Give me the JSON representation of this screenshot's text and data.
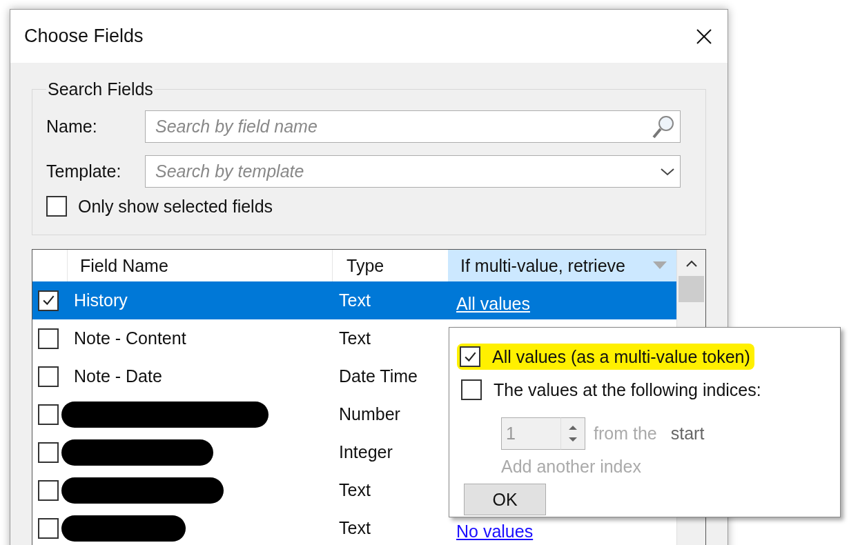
{
  "window": {
    "title": "Choose Fields"
  },
  "search_fields": {
    "legend": "Search Fields",
    "name": {
      "label": "Name:",
      "placeholder": "Search by field name"
    },
    "template": {
      "label": "Template:",
      "placeholder": "Search by template"
    },
    "only_selected": {
      "label": "Only show selected fields",
      "checked": false
    }
  },
  "table": {
    "columns": [
      "Field Name",
      "Type",
      "If multi-value, retrieve"
    ],
    "rows": [
      {
        "name": "History",
        "type": "Text",
        "retrieve": "All values",
        "checked": true,
        "selected": true,
        "redacted": false
      },
      {
        "name": "Note - Content",
        "type": "Text",
        "checked": false,
        "selected": false,
        "redacted": false
      },
      {
        "name": "Note - Date",
        "type": "Date Time",
        "checked": false,
        "selected": false,
        "redacted": false
      },
      {
        "type": "Number",
        "checked": false,
        "selected": false,
        "redacted": true
      },
      {
        "type": "Integer",
        "checked": false,
        "selected": false,
        "redacted": true
      },
      {
        "type": "Text",
        "checked": false,
        "selected": false,
        "redacted": true
      },
      {
        "type": "Text",
        "retrieve": "No values",
        "checked": false,
        "selected": false,
        "redacted": true
      }
    ]
  },
  "popup": {
    "options": [
      {
        "label": "All values (as a multi-value token)",
        "checked": true,
        "highlighted": true
      },
      {
        "label": "The values at the following indices:",
        "checked": false,
        "highlighted": false
      }
    ],
    "index": {
      "value": "1",
      "from_label": "from the",
      "anchor": "start",
      "add_label": "Add another index",
      "disabled": true
    },
    "ok": "OK"
  }
}
